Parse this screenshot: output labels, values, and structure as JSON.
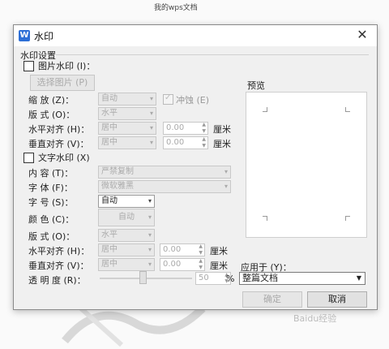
{
  "document": {
    "title": "我的wps文档"
  },
  "dialog": {
    "title": "水印",
    "section": "水印设置",
    "picture": {
      "checkbox_label": "图片水印 (I)：",
      "select_button": "选择图片 (P)",
      "scale_label": "缩  放 (Z)：",
      "scale_value": "自动",
      "washout_label": "冲蚀 (E)",
      "layout_label": "版  式 (O)：",
      "layout_value": "水平",
      "halign_label": "水平对齐 (H)：",
      "halign_value": "居中",
      "halign_offset": "0.00",
      "valign_label": "垂直对齐 (V)：",
      "valign_value": "居中",
      "valign_offset": "0.00",
      "unit": "厘米"
    },
    "text": {
      "checkbox_label": "文字水印 (X)",
      "content_label": "内  容 (T)：",
      "content_value": "严禁复制",
      "font_label": "字  体 (F)：",
      "font_value": "微软雅黑",
      "size_label": "字  号 (S)：",
      "size_value": "自动",
      "color_label": "颜  色 (C)：",
      "color_value": "自动",
      "layout_label": "版  式 (O)：",
      "layout_value": "水平",
      "halign_label": "水平对齐 (H)：",
      "halign_value": "居中",
      "halign_offset": "0.00",
      "valign_label": "垂直对齐 (V)：",
      "valign_value": "居中",
      "valign_offset": "0.00",
      "unit": "厘米",
      "transparency_label": "透 明 度 (R)：",
      "transparency_value": "50",
      "transparency_unit": "%"
    },
    "preview_label": "预览",
    "apply_label": "应用于 (Y)：",
    "apply_value": "整篇文档",
    "ok_button": "确定",
    "cancel_button": "取消"
  },
  "watermark_text": "Baidu经验",
  "colors": {
    "accent": "#2d6fd6",
    "dialog_bg": "#f0f0f0"
  }
}
